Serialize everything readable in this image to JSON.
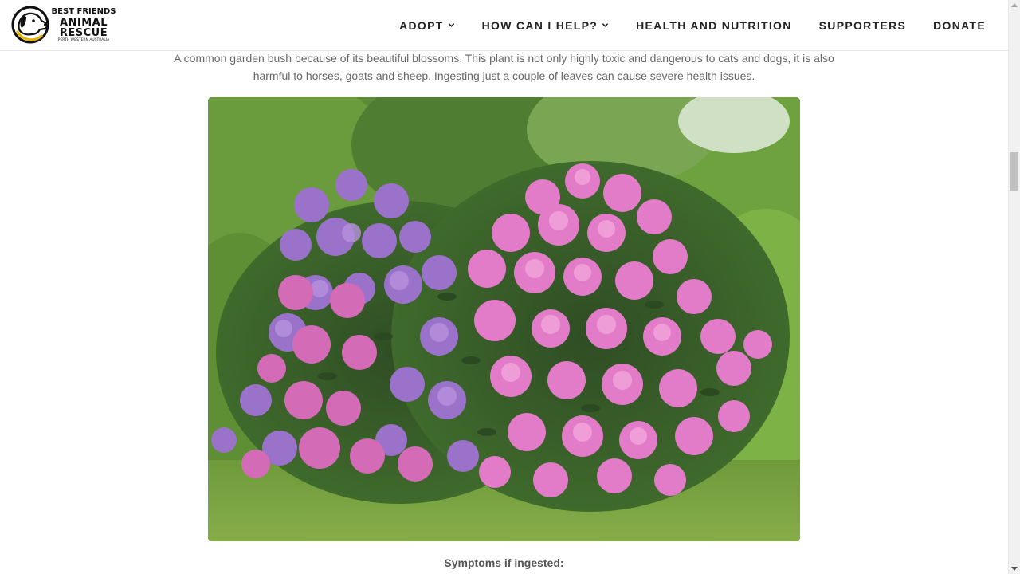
{
  "header": {
    "logo": {
      "line1": "BEST FRIENDS",
      "line2": "ANIMAL",
      "line3": "RESCUE",
      "line4": "PERTH WESTERN AUSTRALIA"
    },
    "nav": [
      {
        "label": "ADOPT",
        "has_dropdown": true
      },
      {
        "label": "HOW CAN I HELP?",
        "has_dropdown": true
      },
      {
        "label": "HEALTH AND NUTRITION",
        "has_dropdown": false
      },
      {
        "label": "SUPPORTERS",
        "has_dropdown": false
      },
      {
        "label": "DONATE",
        "has_dropdown": false
      }
    ]
  },
  "content": {
    "intro_line1": "A common garden bush because of its beautiful blossoms. This plant is not only highly toxic and dangerous to cats and dogs, it is also",
    "intro_line2": "harmful to horses, goats and sheep. Ingesting just a couple of leaves can cause severe health issues.",
    "symptoms_heading": "Symptoms if ingested:"
  },
  "icons": {
    "logo": "dog-head-logo-icon",
    "dropdown": "chevron-down-icon",
    "photo": "rhododendron-bush-photo"
  },
  "colors": {
    "nav_text": "#222222",
    "body_text": "#666666",
    "header_border": "#e6e6e6"
  }
}
